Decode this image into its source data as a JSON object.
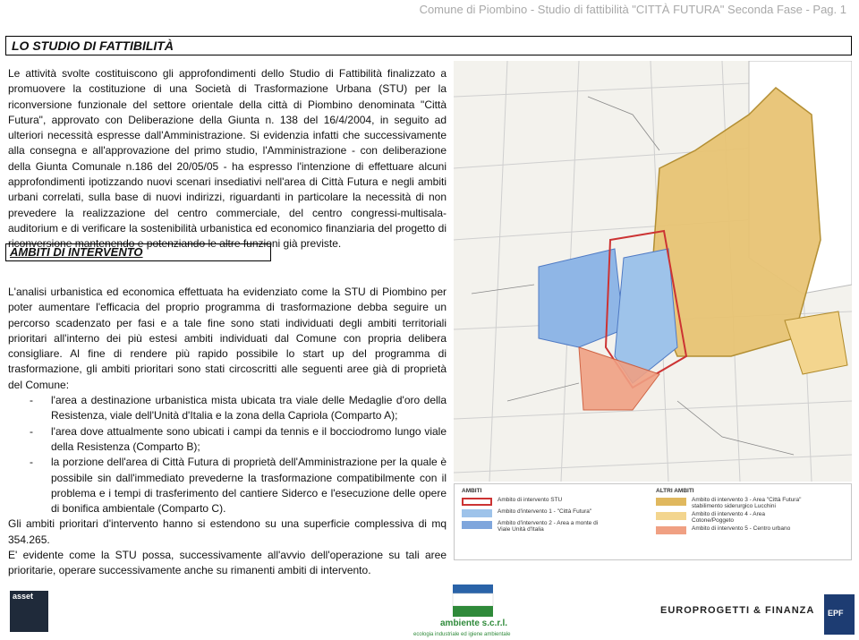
{
  "header": "Comune di Piombino - Studio di fattibilità \"CITTÀ FUTURA\" Seconda Fase - Pag. 1",
  "title": "LO STUDIO DI FATTIBILITÀ",
  "para1": "Le attività svolte costituiscono gli approfondimenti dello Studio di Fattibilità finalizzato a promuovere la costituzione di una Società di Trasformazione Urbana (STU) per la riconversione funzionale del settore orientale della città di Piombino denominata \"Città Futura\", approvato con Deliberazione della Giunta n. 138 del 16/4/2004, in seguito ad ulteriori necessità espresse dall'Amministrazione. Si evidenzia infatti che successivamente alla consegna e all'approvazione del primo studio, l'Amministrazione - con deliberazione della Giunta Comunale n.186 del 20/05/05 - ha espresso l'intenzione di effettuare alcuni approfondimenti ipotizzando nuovi scenari insediativi nell'area di Città Futura e negli ambiti urbani correlati, sulla base di nuovi indirizzi, riguardanti in particolare la necessità di non prevedere la realizzazione del centro commerciale, del centro congressi-multisala-auditorium e di verificare la sostenibilità urbanistica ed economico finanziaria del progetto di riconversione mantenendo e potenziando le altre funzioni già previste.",
  "ambiti_title": "AMBITI DI INTERVENTO",
  "para2_intro": "L'analisi urbanistica ed economica effettuata ha evidenziato come la STU di Piombino per poter aumentare l'efficacia del proprio programma di trasformazione debba seguire un percorso scadenzato per fasi e a tale fine sono stati individuati degli ambiti territoriali prioritari all'interno dei più estesi ambiti individuati dal Comune con propria delibera consigliare. Al fine di rendere più rapido possibile lo start up del programma di trasformazione, gli ambiti prioritari sono stati circoscritti alle seguenti aree già di proprietà del Comune:",
  "bullets": [
    {
      "dash": "-",
      "text": "l'area a destinazione urbanistica mista ubicata tra viale delle Medaglie d'oro della Resistenza, viale dell'Unità d'Italia e la zona della Capriola (Comparto A);"
    },
    {
      "dash": "-",
      "text": "l'area dove attualmente sono ubicati i campi da tennis e il bocciodromo lungo viale della Resistenza (Comparto B);"
    },
    {
      "dash": "-",
      "text": "la porzione dell'area di Città Futura di proprietà dell'Amministrazione per la quale è possibile sin dall'immediato prevederne la trasformazione compatibilmente con il problema e i tempi di trasferimento del cantiere Siderco e l'esecuzione delle opere di bonifica ambientale (Comparto C)."
    }
  ],
  "para2_end": "Gli ambiti prioritari d'intervento hanno si estendono su una superficie complessiva di mq 354.265.",
  "para2_end2": "E' evidente come la STU possa, successivamente all'avvio dell'operazione su tali aree prioritarie, operare successivamente anche su rimanenti ambiti di intervento.",
  "legend": {
    "col1_title": "AMBITI",
    "col1": [
      {
        "label": "Ambito di intervento STU",
        "color": "#cc3333"
      },
      {
        "label": "Ambito d'intervento 1 - \"Città Futura\"",
        "color": "#9ec3ea"
      },
      {
        "label": "Ambito d'intervento 2 - Area a monte di",
        "label2": "Viale Unità d'Italia",
        "color": "#7fa6dc"
      }
    ],
    "col2_title": "ALTRI AMBITI",
    "col2": [
      {
        "label": "Ambito di intervento 3 - Area \"Città Futura\"",
        "label2": "stabilimento siderurgico Lucchini",
        "color": "#e0b85e"
      },
      {
        "label": "Ambito di intervento 4 - Area",
        "label2": "Cotone/Poggeto",
        "color": "#f3d58e"
      },
      {
        "label": "Ambito di intervento 5 - Centro urbano",
        "color": "#f0a083"
      }
    ]
  },
  "footer": {
    "left_logo": "asset",
    "center_name": "ambiente s.c.r.l.",
    "center_tagline": "ecologia industriale ed igiene ambientale",
    "right_name": "EUROPROGETTI & FINANZA",
    "right_logo": "EPF"
  },
  "colors": {
    "blue": "#8fb6e6",
    "orange": "#e8b96a",
    "red": "#e88a6d",
    "map_bg": "#f3f2ed"
  },
  "icons": [
    "city-map",
    "asset-logo",
    "ambiente-logo",
    "epf-logo"
  ]
}
